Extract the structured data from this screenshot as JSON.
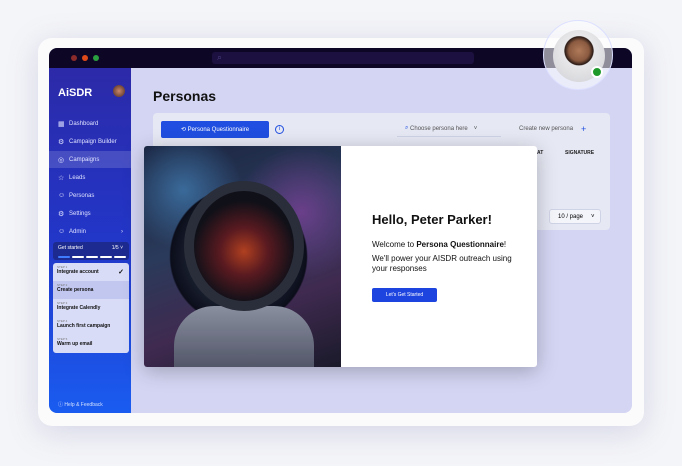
{
  "app": {
    "logo": "AiSDR"
  },
  "sidebar": {
    "items": [
      {
        "label": "Dashboard",
        "icon": "dashboard-icon",
        "glyph": "▦"
      },
      {
        "label": "Campaign Builder",
        "icon": "builder-icon",
        "glyph": "⚙"
      },
      {
        "label": "Campaigns",
        "icon": "campaigns-icon",
        "glyph": "◎"
      },
      {
        "label": "Leads",
        "icon": "star-icon",
        "glyph": "☆"
      },
      {
        "label": "Personas",
        "icon": "personas-icon",
        "glyph": "☺"
      },
      {
        "label": "Settings",
        "icon": "settings-icon",
        "glyph": "⚙"
      },
      {
        "label": "Admin",
        "icon": "admin-icon",
        "glyph": "☺"
      }
    ],
    "get_started": {
      "label": "Get started",
      "progress": "1/5"
    },
    "steps": [
      {
        "step": "STEP 1",
        "label": "Integrate account",
        "done": true
      },
      {
        "step": "STEP 2",
        "label": "Create persona"
      },
      {
        "step": "STEP 3",
        "label": "Integrate Calendly"
      },
      {
        "step": "STEP 4",
        "label": "Launch first campaign"
      },
      {
        "step": "STEP 5",
        "label": "Warm up email"
      }
    ],
    "help": "Help & Feedback"
  },
  "main": {
    "title": "Personas",
    "questionnaire_button": "Persona Questionnaire",
    "choose_placeholder": "Choose persona here",
    "create_button": "Create new persona",
    "columns": [
      "AT",
      "SIGNATURE"
    ],
    "per_page": "10 / page"
  },
  "modal": {
    "greeting": "Hello, Peter Parker!",
    "welcome_prefix": "Welcome to ",
    "welcome_bold": "Persona Questionnaire",
    "welcome_suffix": "!",
    "body": "We'll power your AISDR outreach using your responses",
    "button": "Let's Get Started"
  },
  "colors": {
    "accent": "#1f4ee0",
    "online": "#1f9a2a"
  }
}
